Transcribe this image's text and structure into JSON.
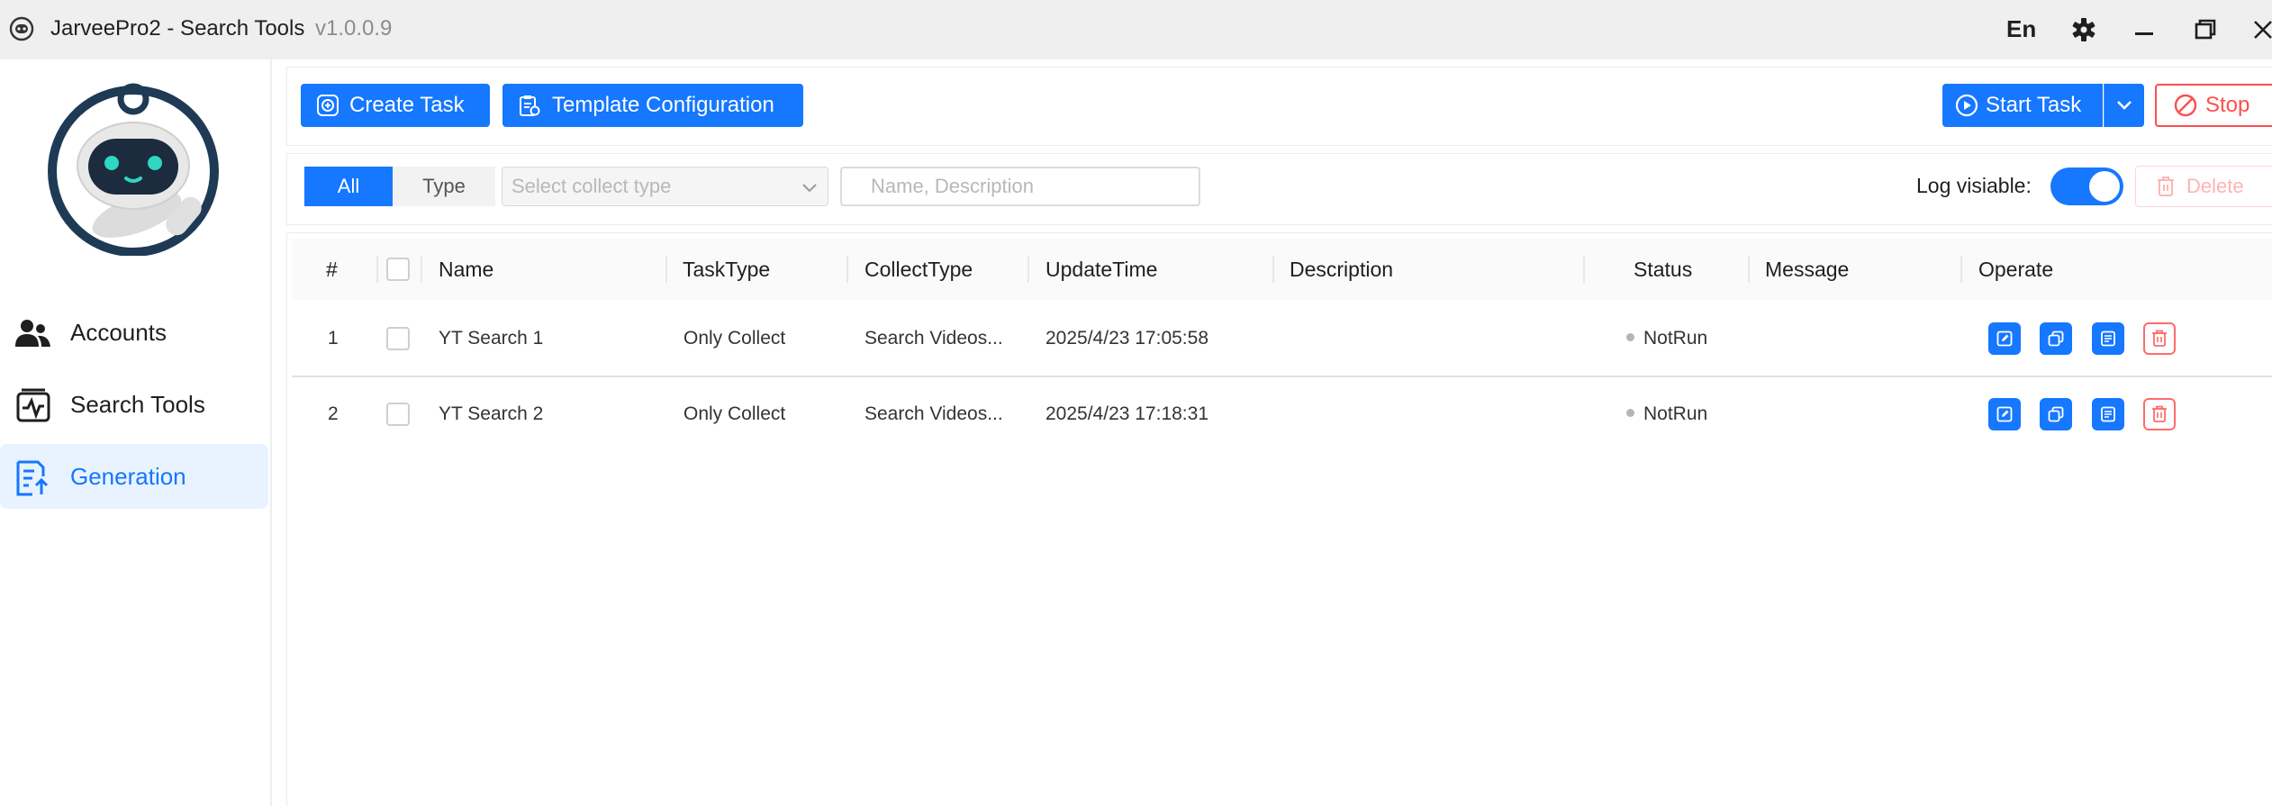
{
  "window": {
    "title": "JarveePro2 - Search Tools",
    "version": "v1.0.0.9",
    "language": "En",
    "icons": [
      "settings-icon",
      "minimize-icon",
      "restore-icon",
      "close-icon"
    ]
  },
  "sidebar": {
    "items": [
      {
        "label": "Accounts",
        "icon": "users-icon",
        "active": false
      },
      {
        "label": "Search Tools",
        "icon": "search-tools-icon",
        "active": false
      },
      {
        "label": "Generation",
        "icon": "generation-icon",
        "active": true
      }
    ]
  },
  "toolbar": {
    "create_task": "Create Task",
    "template_configuration": "Template Configuration",
    "start_task": "Start Task",
    "stop": "Stop"
  },
  "filters": {
    "segment_all": "All",
    "segment_type": "Type",
    "collect_type_placeholder": "Select collect type",
    "search_placeholder": "Name, Description",
    "log_visible_label": "Log visiable:",
    "log_visible_on": true,
    "delete": "Delete"
  },
  "table": {
    "headers": {
      "index": "#",
      "name": "Name",
      "task_type": "TaskType",
      "collect_type": "CollectType",
      "update_time": "UpdateTime",
      "description": "Description",
      "status": "Status",
      "message": "Message",
      "operate": "Operate"
    },
    "rows": [
      {
        "index": "1",
        "name": "YT Search 1",
        "task_type": "Only Collect",
        "collect_type": "Search Videos...",
        "update_time": "2025/4/23 17:05:58",
        "description": "",
        "status": "NotRun",
        "message": ""
      },
      {
        "index": "2",
        "name": "YT Search 2",
        "task_type": "Only Collect",
        "collect_type": "Search Videos...",
        "update_time": "2025/4/23 17:18:31",
        "description": "",
        "status": "NotRun",
        "message": ""
      }
    ]
  },
  "colors": {
    "primary": "#1677ff",
    "danger": "#ff4d4f",
    "active_nav_bg": "#e8f3ff"
  }
}
